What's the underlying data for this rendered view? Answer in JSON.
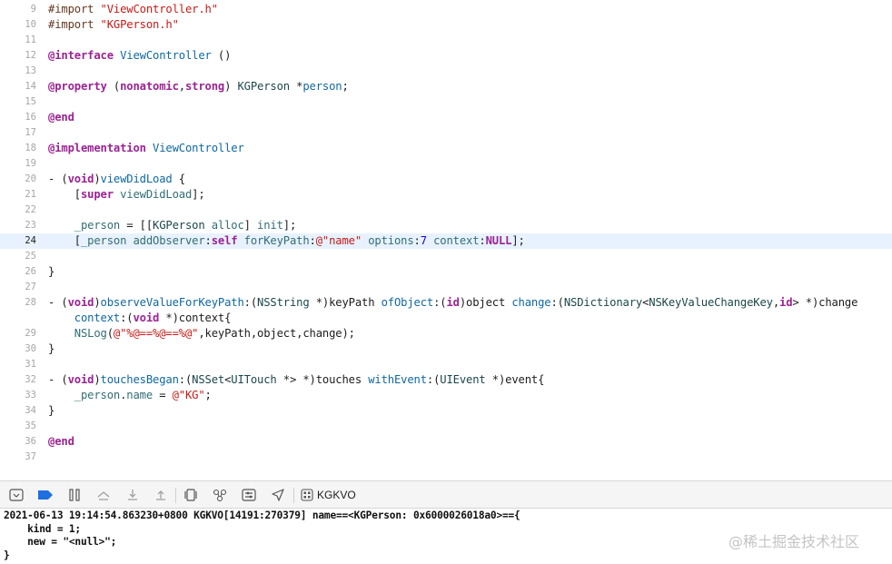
{
  "editor": {
    "current_line": "24",
    "lines": [
      {
        "num": "9",
        "tokens": [
          [
            "pp",
            "#import "
          ],
          [
            "str",
            "\"ViewController.h\""
          ]
        ]
      },
      {
        "num": "10",
        "tokens": [
          [
            "pp",
            "#import "
          ],
          [
            "str",
            "\"KGPerson.h\""
          ]
        ]
      },
      {
        "num": "11",
        "tokens": []
      },
      {
        "num": "12",
        "tokens": [
          [
            "kw",
            "@interface"
          ],
          [
            "pl",
            " "
          ],
          [
            "decl",
            "ViewController"
          ],
          [
            "pl",
            " ()"
          ]
        ]
      },
      {
        "num": "13",
        "tokens": []
      },
      {
        "num": "14",
        "tokens": [
          [
            "kw",
            "@property"
          ],
          [
            "pl",
            " ("
          ],
          [
            "kw",
            "nonatomic"
          ],
          [
            "pl",
            ","
          ],
          [
            "kw",
            "strong"
          ],
          [
            "pl",
            ") "
          ],
          [
            "type",
            "KGPerson"
          ],
          [
            "pl",
            " *"
          ],
          [
            "decl",
            "person"
          ],
          [
            "pl",
            ";"
          ]
        ]
      },
      {
        "num": "15",
        "tokens": []
      },
      {
        "num": "16",
        "tokens": [
          [
            "kw",
            "@end"
          ]
        ]
      },
      {
        "num": "17",
        "tokens": []
      },
      {
        "num": "18",
        "tokens": [
          [
            "kw",
            "@implementation"
          ],
          [
            "pl",
            " "
          ],
          [
            "decl",
            "ViewController"
          ]
        ]
      },
      {
        "num": "19",
        "tokens": []
      },
      {
        "num": "20",
        "tokens": [
          [
            "pl",
            "- ("
          ],
          [
            "kw",
            "void"
          ],
          [
            "pl",
            ")"
          ],
          [
            "decl",
            "viewDidLoad"
          ],
          [
            "pl",
            " {"
          ]
        ]
      },
      {
        "num": "21",
        "tokens": [
          [
            "pl",
            "    ["
          ],
          [
            "kw",
            "super"
          ],
          [
            "pl",
            " "
          ],
          [
            "m",
            "viewDidLoad"
          ],
          [
            "pl",
            "];"
          ]
        ]
      },
      {
        "num": "22",
        "tokens": []
      },
      {
        "num": "23",
        "tokens": [
          [
            "pl",
            "    "
          ],
          [
            "m",
            "_person"
          ],
          [
            "pl",
            " = [["
          ],
          [
            "type",
            "KGPerson"
          ],
          [
            "pl",
            " "
          ],
          [
            "m",
            "alloc"
          ],
          [
            "pl",
            "] "
          ],
          [
            "m",
            "init"
          ],
          [
            "pl",
            "];"
          ]
        ]
      },
      {
        "num": "24",
        "tokens": [
          [
            "pl",
            "    ["
          ],
          [
            "m",
            "_person"
          ],
          [
            "pl",
            " "
          ],
          [
            "m",
            "addObserver"
          ],
          [
            "pl",
            ":"
          ],
          [
            "kw",
            "self"
          ],
          [
            "pl",
            " "
          ],
          [
            "m",
            "forKeyPath"
          ],
          [
            "pl",
            ":"
          ],
          [
            "str",
            "@\"name\""
          ],
          [
            "pl",
            " "
          ],
          [
            "m",
            "options"
          ],
          [
            "pl",
            ":"
          ],
          [
            "num",
            "7"
          ],
          [
            "pl",
            " "
          ],
          [
            "m",
            "context"
          ],
          [
            "pl",
            ":"
          ],
          [
            "kw",
            "NULL"
          ],
          [
            "pl",
            "];"
          ]
        ]
      },
      {
        "num": "25",
        "tokens": []
      },
      {
        "num": "26",
        "tokens": [
          [
            "pl",
            "}"
          ]
        ]
      },
      {
        "num": "27",
        "tokens": []
      },
      {
        "num": "28",
        "tokens": [
          [
            "pl",
            "- ("
          ],
          [
            "kw",
            "void"
          ],
          [
            "pl",
            ")"
          ],
          [
            "decl",
            "observeValueForKeyPath"
          ],
          [
            "pl",
            ":("
          ],
          [
            "type",
            "NSString"
          ],
          [
            "pl",
            " *)keyPath "
          ],
          [
            "decl",
            "ofObject"
          ],
          [
            "pl",
            ":("
          ],
          [
            "kw",
            "id"
          ],
          [
            "pl",
            ")object "
          ],
          [
            "decl",
            "change"
          ],
          [
            "pl",
            ":("
          ],
          [
            "type",
            "NSDictionary"
          ],
          [
            "pl",
            "<"
          ],
          [
            "type",
            "NSKeyValueChangeKey"
          ],
          [
            "pl",
            ","
          ],
          [
            "kw",
            "id"
          ],
          [
            "pl",
            "> *)change"
          ]
        ]
      },
      {
        "num": "",
        "tokens": [
          [
            "pl",
            "    "
          ],
          [
            "decl",
            "context"
          ],
          [
            "pl",
            ":("
          ],
          [
            "kw",
            "void"
          ],
          [
            "pl",
            " *)context{"
          ]
        ]
      },
      {
        "num": "29",
        "tokens": [
          [
            "pl",
            "    "
          ],
          [
            "m",
            "NSLog"
          ],
          [
            "pl",
            "("
          ],
          [
            "str",
            "@\"%@==%@==%@\""
          ],
          [
            "pl",
            ",keyPath,object,change);"
          ]
        ]
      },
      {
        "num": "30",
        "tokens": [
          [
            "pl",
            "}"
          ]
        ]
      },
      {
        "num": "31",
        "tokens": []
      },
      {
        "num": "32",
        "tokens": [
          [
            "pl",
            "- ("
          ],
          [
            "kw",
            "void"
          ],
          [
            "pl",
            ")"
          ],
          [
            "decl",
            "touchesBegan"
          ],
          [
            "pl",
            ":("
          ],
          [
            "type",
            "NSSet"
          ],
          [
            "pl",
            "<"
          ],
          [
            "type",
            "UITouch"
          ],
          [
            "pl",
            " *> *)touches "
          ],
          [
            "decl",
            "withEvent"
          ],
          [
            "pl",
            ":("
          ],
          [
            "type",
            "UIEvent"
          ],
          [
            "pl",
            " *)event{"
          ]
        ]
      },
      {
        "num": "33",
        "tokens": [
          [
            "pl",
            "    "
          ],
          [
            "m",
            "_person"
          ],
          [
            "pl",
            "."
          ],
          [
            "m",
            "name"
          ],
          [
            "pl",
            " = "
          ],
          [
            "str",
            "@\"KG\""
          ],
          [
            "pl",
            ";"
          ]
        ]
      },
      {
        "num": "34",
        "tokens": [
          [
            "pl",
            "}"
          ]
        ]
      },
      {
        "num": "35",
        "tokens": []
      },
      {
        "num": "36",
        "tokens": [
          [
            "kw",
            "@end"
          ]
        ]
      },
      {
        "num": "37",
        "tokens": []
      }
    ]
  },
  "debug_bar": {
    "process_label": "KGKVO",
    "icons": [
      "hide-console-icon",
      "breakpoints-toggle-icon",
      "pause-continue-icon",
      "step-over-icon",
      "step-into-icon",
      "step-out-icon",
      "view-hierarchy-icon",
      "memory-graph-icon",
      "environment-overrides-icon",
      "simulate-location-icon",
      "process-icon"
    ]
  },
  "console": {
    "lines": [
      "2021-06-13 19:14:54.863230+0800 KGKVO[14191:270379] name==<KGPerson: 0x6000026018a0>=={",
      "    kind = 1;",
      "    new = \"<null>\";",
      "}"
    ]
  },
  "watermark": "@稀土掘金技术社区",
  "colors": {
    "keyword": "#9b2393",
    "string": "#c41a16",
    "preprocessor": "#643820",
    "type": "#1c464a",
    "declaration": "#0f68a0",
    "method": "#326d74",
    "number": "#1c00cf",
    "current_line_bg": "#e8f2ff",
    "breakpoint_blue": "#1f6fe0"
  }
}
